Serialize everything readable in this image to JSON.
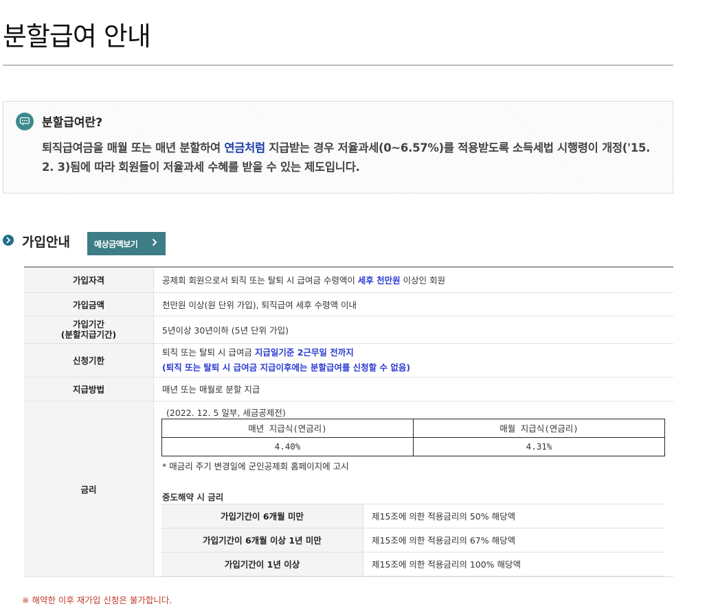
{
  "page_title": "분할급여 안내",
  "info": {
    "heading": "분할급여란?",
    "text_before": "퇴직급여금을 매월 또는 매년 분할하여 ",
    "text_highlight": "연금처럼",
    "text_after": " 지급받는 경우 저율과세(0~6.57%)를 적용받도록 소득세법 시행령이 개정('15. 2. 3)됨에 따라 회원들이 저율과세 수혜를 받을 수 있는 제도입니다."
  },
  "join": {
    "section_label": "가입안내",
    "estimate_button": "예상금액보기"
  },
  "table": {
    "qualification": {
      "label": "가입자격",
      "before": "공제회 회원으로서 퇴직 또는 탈퇴 시 급여금 수령액이 ",
      "highlight": "세후 천만원",
      "after": " 이상인 회원"
    },
    "amount": {
      "label": "가입금액",
      "value": "천만원 이상(원 단위 가입), 퇴직급여 세후 수령액 이내"
    },
    "period": {
      "label_line1": "가입기간",
      "label_line2": "(분할지급기간)",
      "value": "5년이상 30년이하 (5년 단위 가입)"
    },
    "deadline": {
      "label": "신청기한",
      "line1_before": "퇴직 또는 탈퇴 시 급여금 ",
      "line1_highlight": "지급일기준 2근무일 전까지",
      "line2": "(퇴직 또는 탈퇴 시 급여금 지급이후에는 분할급여를 신청할 수 없음)"
    },
    "method": {
      "label": "지급방법",
      "value": "매년 또는 매월로 분할 지급"
    },
    "rate": {
      "label": "금리",
      "note_top": "(2022. 12. 5 일부, 세금공제전)",
      "annual_header": "매년 지급식(연금리)",
      "monthly_header": "매월 지급식(연금리)",
      "annual_value": "4.40%",
      "monthly_value": "4.31%",
      "note": "* 매금리 주기 변경일에 군인공제회 홈페이지에 고시",
      "mid_heading": "중도해약 시 금리",
      "mid_rows": [
        {
          "period": "가입기간이 6개월 미만",
          "rate": "제15조에 의한 적용금리의 50% 해당액"
        },
        {
          "period": "가입기간이 6개월 이상 1년 미만",
          "rate": "제15조에 의한 적용금리의 67% 해당액"
        },
        {
          "period": "가입기간이 1년 이상",
          "rate": "제15조에 의한 적용금리의 100% 해당액"
        }
      ]
    }
  },
  "footer_note": "※ 해약한 이후 재가입 신청은 불가합니다.",
  "colors": {
    "accent_teal": "#3c7d86",
    "highlight_blue": "#2b3bd1",
    "warning_red": "#c0392b"
  }
}
